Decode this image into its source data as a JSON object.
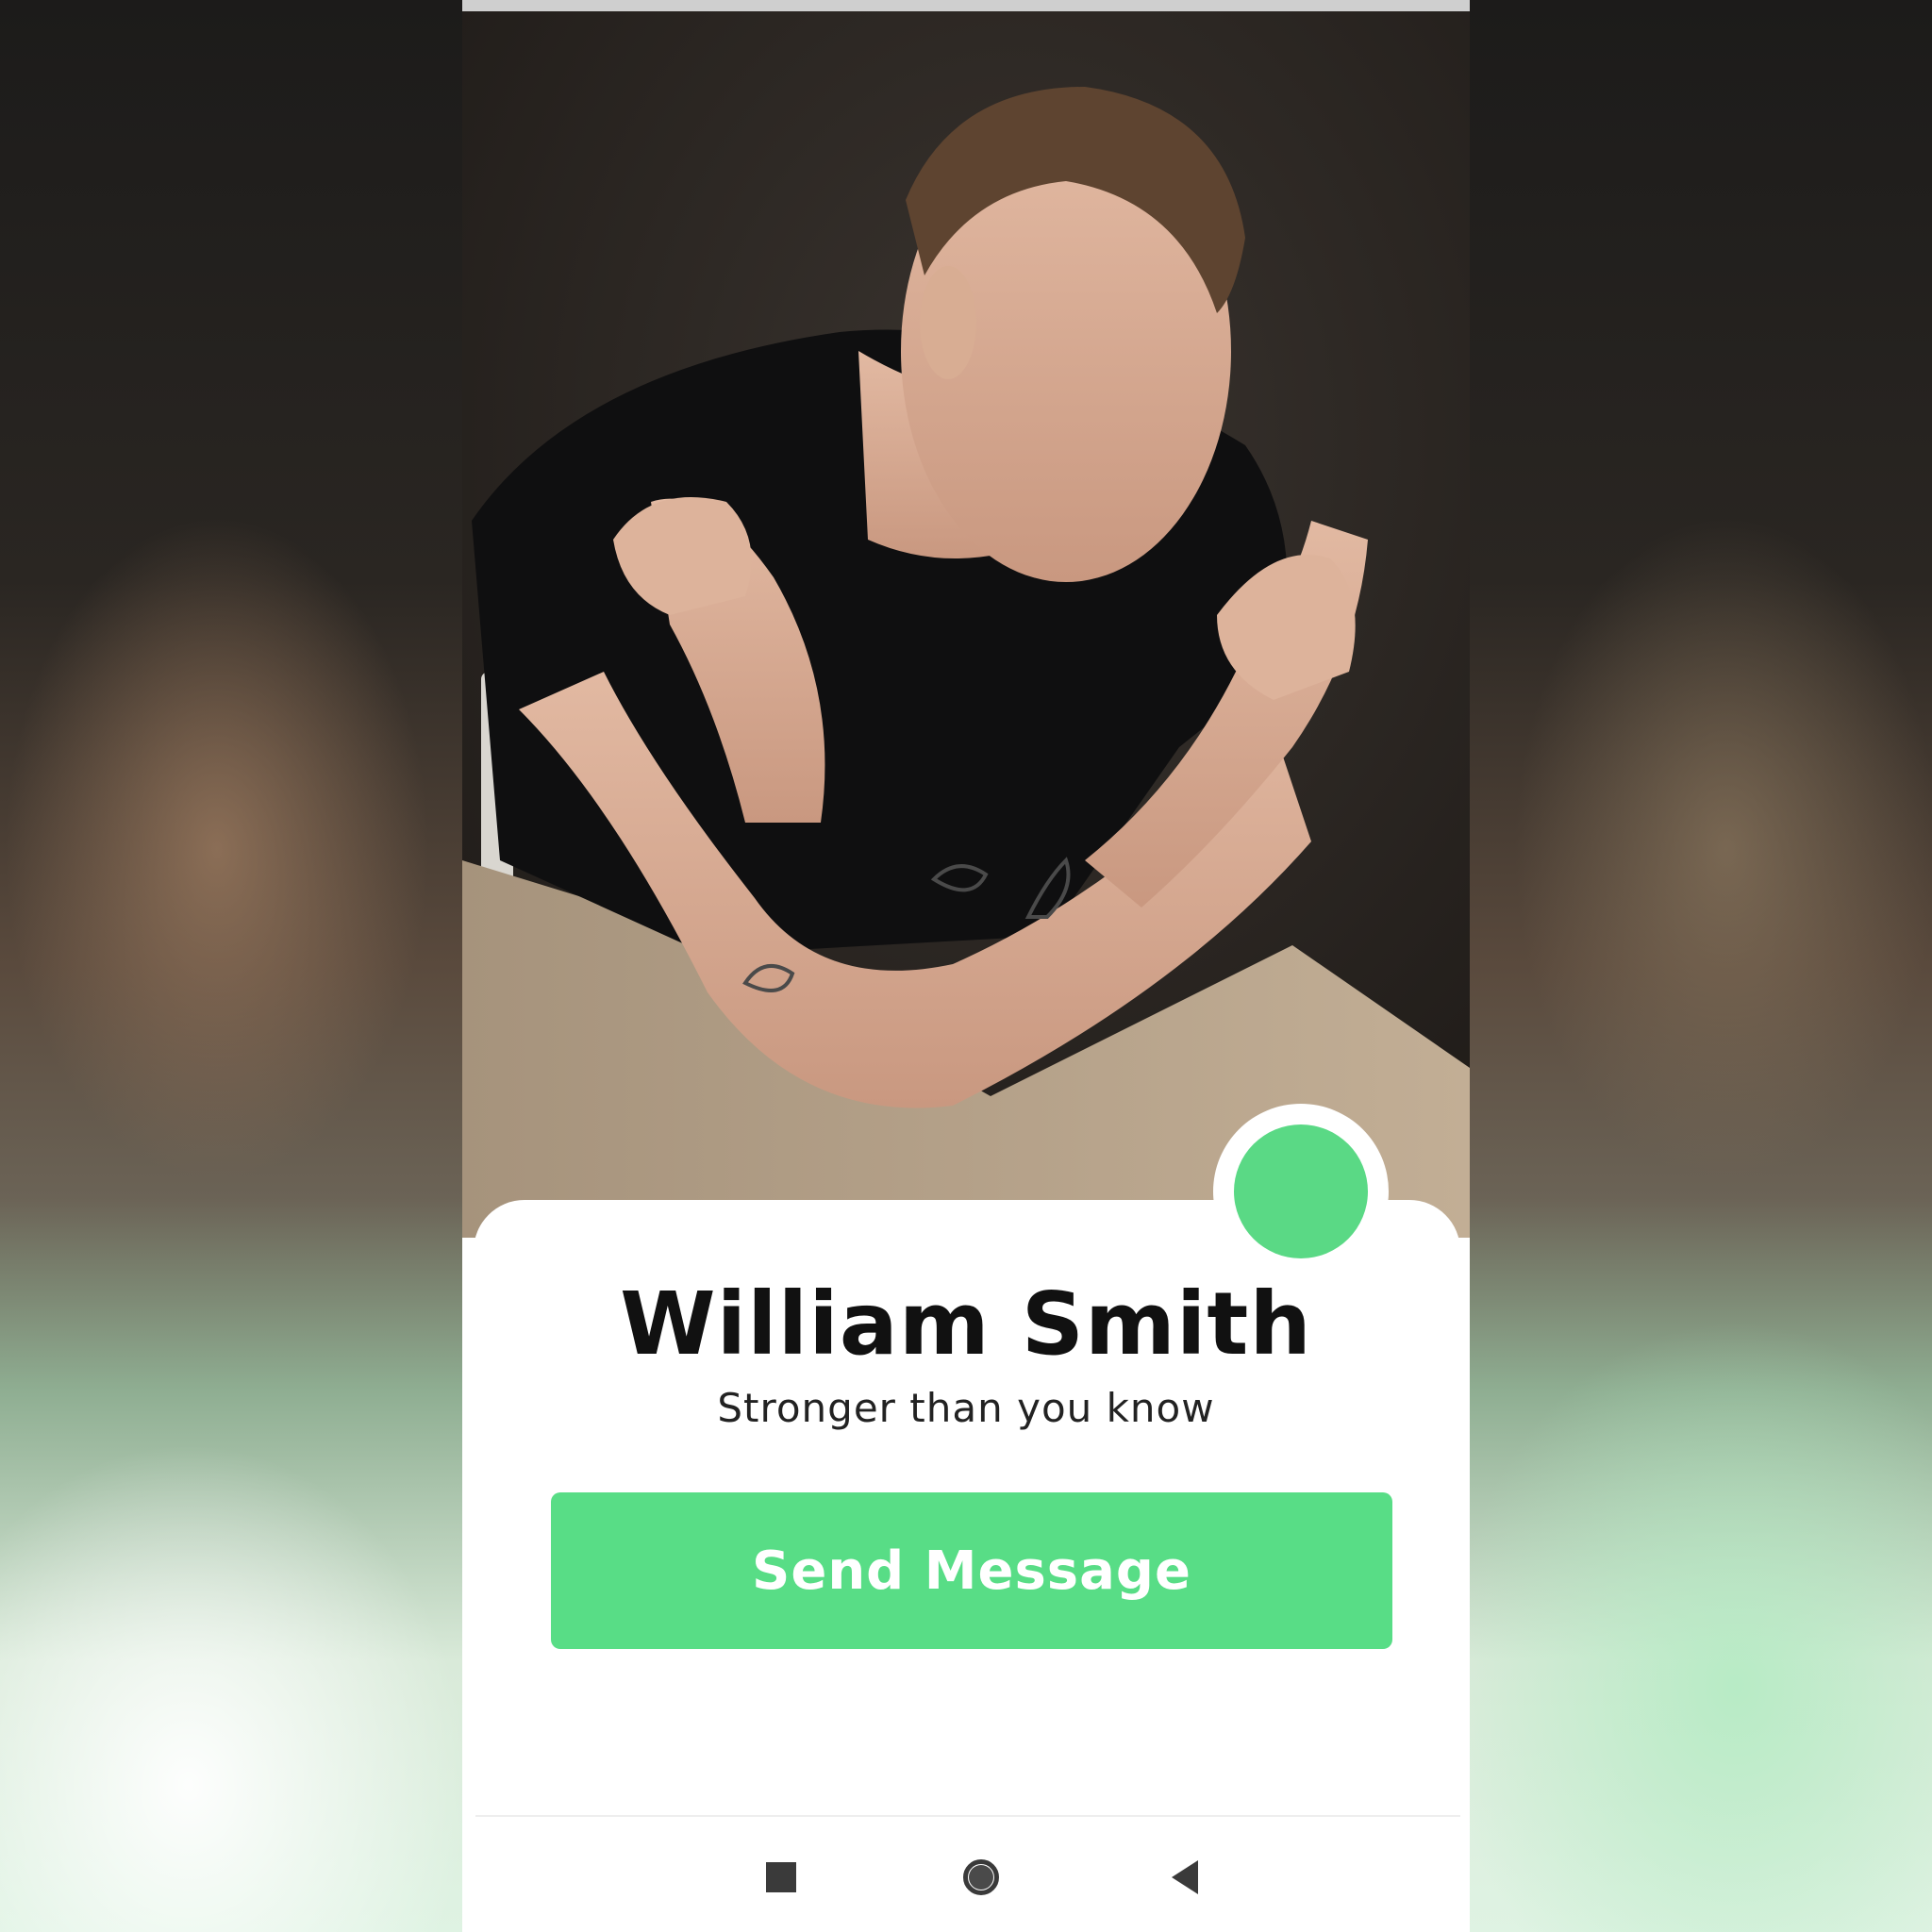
{
  "profile": {
    "name": "William Smith",
    "tagline": "Stronger than you know",
    "online_status_color": "#5ad985",
    "photo_icon": "profile-photo"
  },
  "actions": {
    "send_message_label": "Send Message",
    "accent_color": "#58dd86"
  },
  "navigation": {
    "recents_icon": "square-icon",
    "home_icon": "circle-icon",
    "back_icon": "triangle-back-icon"
  }
}
